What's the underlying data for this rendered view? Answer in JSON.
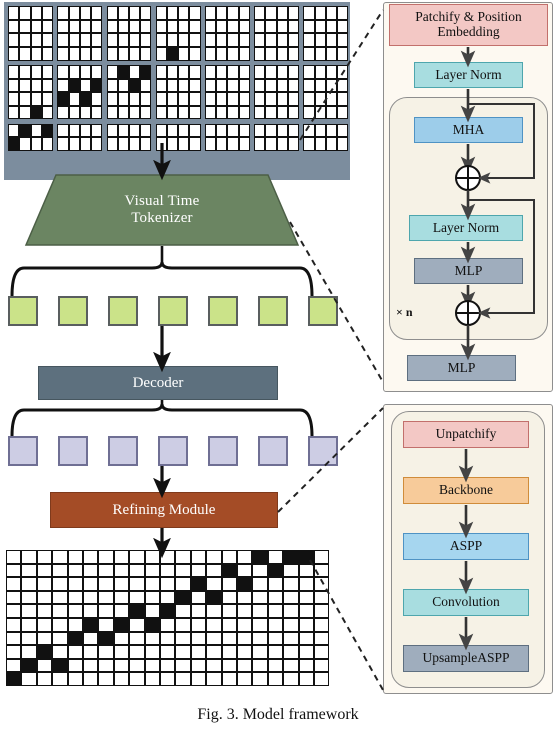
{
  "figure": {
    "caption": "Fig. 3. Model framework"
  },
  "pipeline": {
    "tokenizer_label_line1": "Visual Time",
    "tokenizer_label_line2": "Tokenizer",
    "decoder_label": "Decoder",
    "refiner_label": "Refining Module",
    "token_count_encoded": 7,
    "token_count_decoded": 7
  },
  "encoder_panel": {
    "blocks": [
      {
        "id": "patchify",
        "label": "Patchify & Position Embedding",
        "color": "#f3c8c5"
      },
      {
        "id": "layernorm1",
        "label": "Layer Norm",
        "color": "#a8dde0"
      },
      {
        "id": "mha",
        "label": "MHA",
        "color": "#9dcdea"
      },
      {
        "id": "layernorm2",
        "label": "Layer Norm",
        "color": "#a8dde0"
      },
      {
        "id": "mlp-inner",
        "label": "MLP",
        "color": "#9fadbd"
      },
      {
        "id": "mlp-outer",
        "label": "MLP",
        "color": "#9fadbd"
      }
    ],
    "repeat_label": "× n",
    "residual_symbol": "⊕"
  },
  "refiner_panel": {
    "blocks": [
      {
        "id": "unpatchify",
        "label": "Unpatchify",
        "color": "#f3c8c5"
      },
      {
        "id": "backbone",
        "label": "Backbone",
        "color": "#f7cb9a"
      },
      {
        "id": "aspp",
        "label": "ASPP",
        "color": "#a6d6ef"
      },
      {
        "id": "convolution",
        "label": "Convolution",
        "color": "#a8dde0"
      },
      {
        "id": "upsampleaspp",
        "label": "UpsampleASPP",
        "color": "#9fadbd"
      }
    ]
  },
  "input_grid": {
    "rows": 10,
    "cols": 28,
    "patch_rows": 4,
    "patch_cols": 4,
    "patch_border_color": "#7c8d9e",
    "filled_cells": [
      [
        3,
        13
      ],
      [
        4,
        9
      ],
      [
        4,
        11
      ],
      [
        5,
        5
      ],
      [
        5,
        7
      ],
      [
        5,
        10
      ],
      [
        6,
        4
      ],
      [
        6,
        6
      ],
      [
        7,
        2
      ],
      [
        8,
        1
      ],
      [
        8,
        3
      ],
      [
        9,
        0
      ]
    ]
  },
  "output_grid": {
    "rows": 10,
    "cols": 21,
    "filled_cells": [
      [
        0,
        16
      ],
      [
        0,
        18
      ],
      [
        0,
        19
      ],
      [
        1,
        14
      ],
      [
        1,
        17
      ],
      [
        2,
        12
      ],
      [
        2,
        15
      ],
      [
        3,
        11
      ],
      [
        3,
        13
      ],
      [
        4,
        8
      ],
      [
        4,
        10
      ],
      [
        5,
        5
      ],
      [
        5,
        7
      ],
      [
        5,
        9
      ],
      [
        6,
        4
      ],
      [
        6,
        6
      ],
      [
        7,
        2
      ],
      [
        8,
        1
      ],
      [
        8,
        3
      ],
      [
        9,
        0
      ]
    ]
  },
  "colors": {
    "tokenizer": "#6b8562",
    "decoder": "#5d707e",
    "refiner": "#a44c26",
    "token_encoded": "#cbe389",
    "token_decoded": "#cdcde4",
    "grid_filled": "#111111",
    "grid_empty": "#ffffff"
  }
}
